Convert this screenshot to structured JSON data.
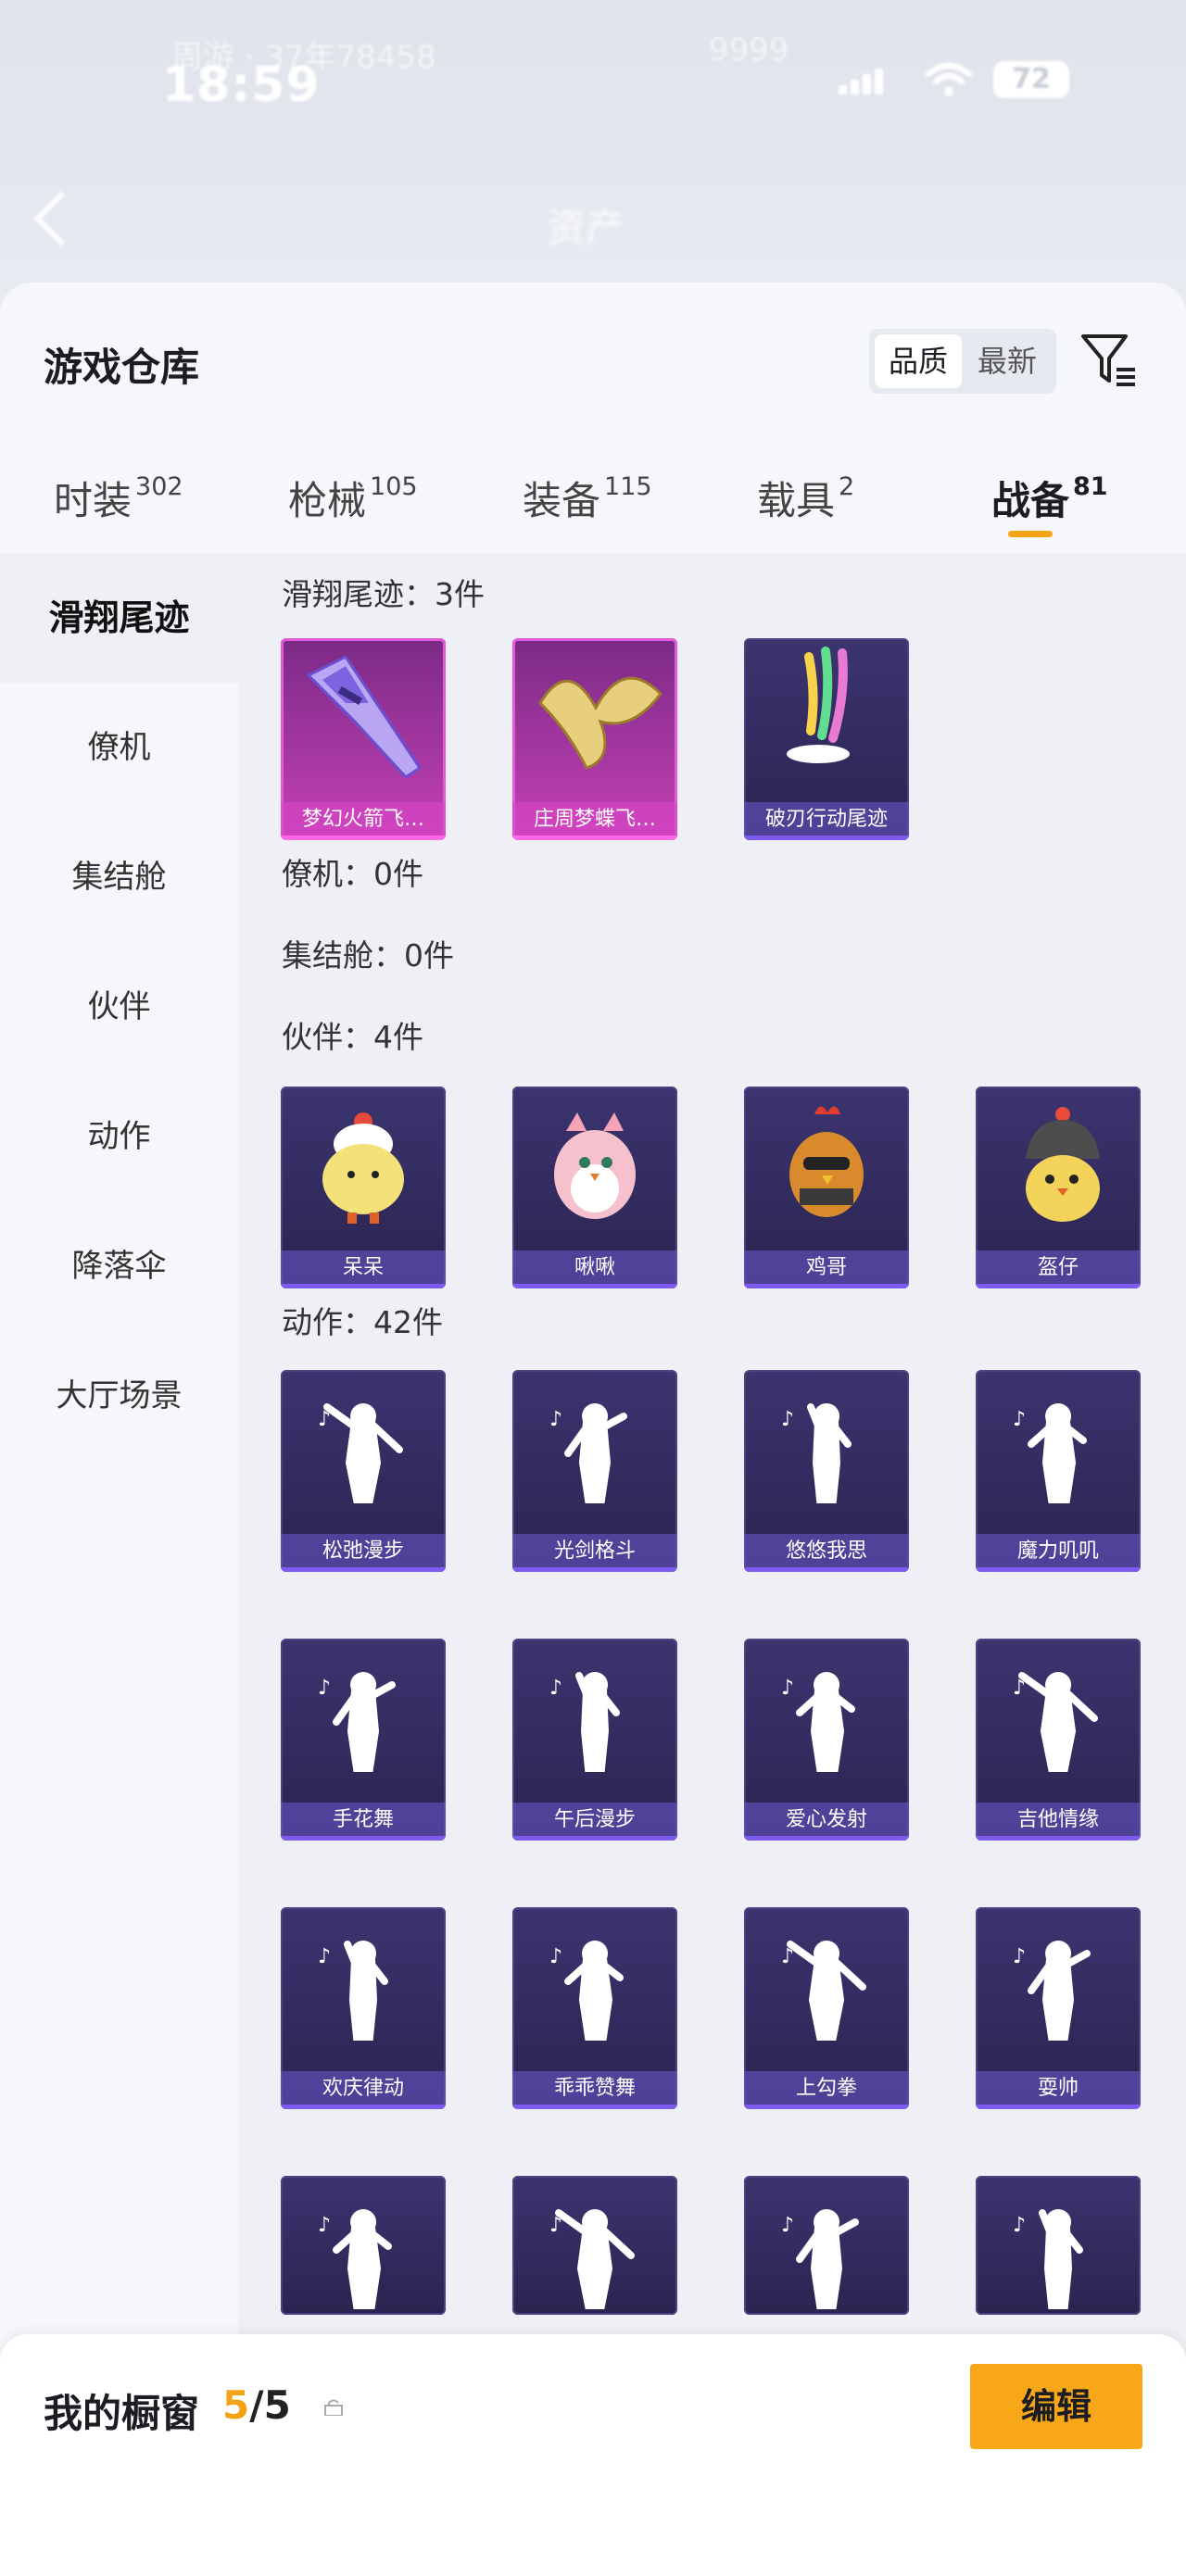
{
  "status_bar": {
    "time": "18:59",
    "ghost_left": "周游 · 37年78458",
    "ghost_right": "9999",
    "battery": "72"
  },
  "background": {
    "title": "资产",
    "nav_items": [
      "",
      "",
      "",
      ""
    ]
  },
  "sheet": {
    "title": "游戏仓库",
    "sort_options": [
      "品质",
      "最新"
    ],
    "active_sort": "品质"
  },
  "tabs": [
    {
      "label": "时装",
      "count": "302"
    },
    {
      "label": "枪械",
      "count": "105"
    },
    {
      "label": "装备",
      "count": "115"
    },
    {
      "label": "载具",
      "count": "2"
    },
    {
      "label": "战备",
      "count": "81"
    }
  ],
  "sidebar": {
    "items": [
      "滑翔尾迹",
      "僚机",
      "集结舱",
      "伙伴",
      "动作",
      "降落伞",
      "大厅场景"
    ],
    "active": "滑翔尾迹"
  },
  "sections": {
    "glide": {
      "title": "滑翔尾迹：3件",
      "items": [
        "梦幻火箭飞…",
        "庄周梦蝶飞…",
        "破刃行动尾迹"
      ]
    },
    "wingman": {
      "title": "僚机：0件"
    },
    "capsule": {
      "title": "集结舱：0件"
    },
    "partner": {
      "title": "伙伴：4件",
      "items": [
        "呆呆",
        "啾啾",
        "鸡哥",
        "盔仔"
      ]
    },
    "action": {
      "title": "动作：42件",
      "items": [
        "松弛漫步",
        "光剑格斗",
        "悠悠我思",
        "魔力叽叽",
        "手花舞",
        "午后漫步",
        "爱心发射",
        "吉他情缘",
        "欢庆律动",
        "乖乖赞舞",
        "上勾拳",
        "耍帅"
      ]
    }
  },
  "bottom_bar": {
    "title": "我的橱窗",
    "count_used": "5",
    "count_sep": "/5",
    "edit_label": "编辑"
  },
  "colors": {
    "accent": "#f5a316",
    "card_purple": "#2e2858",
    "card_pink": "#c541b6"
  }
}
